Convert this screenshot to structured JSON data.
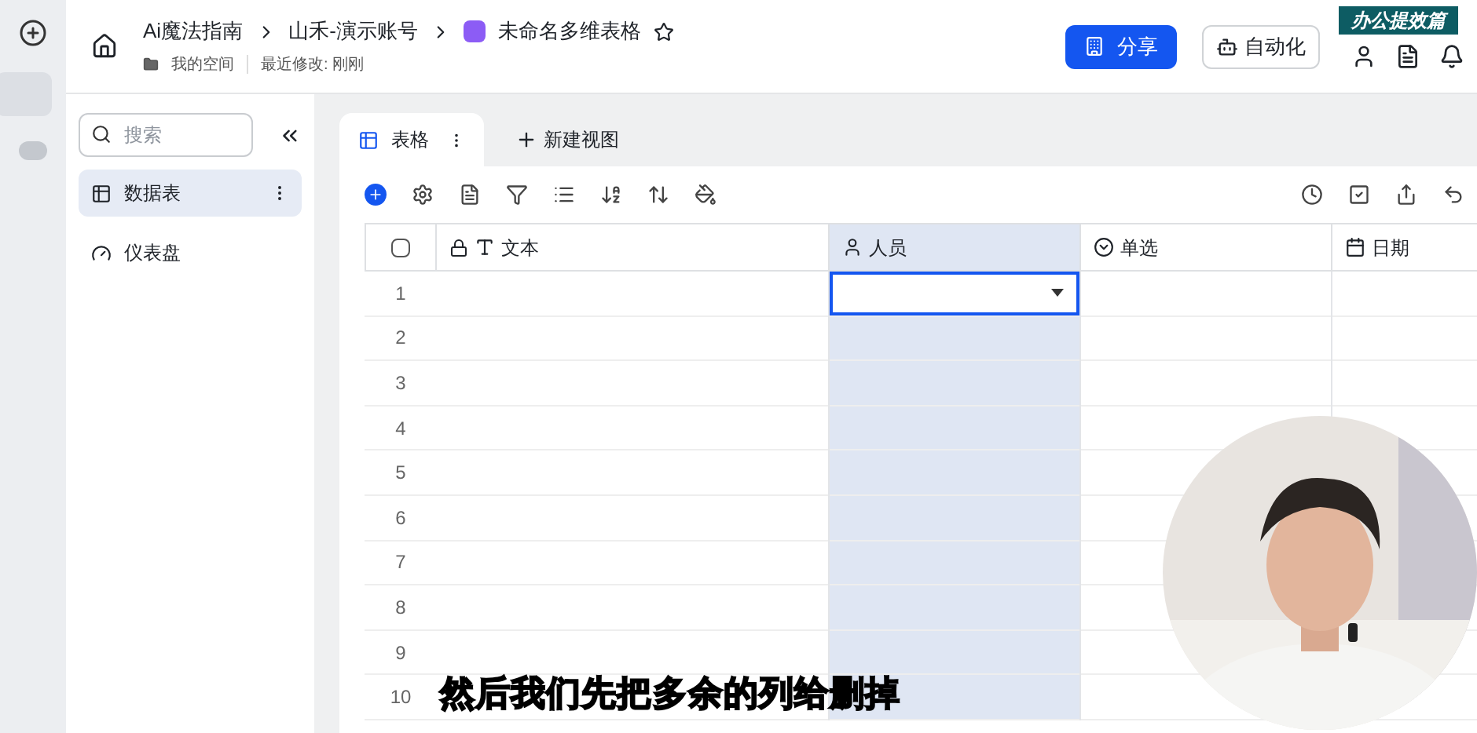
{
  "header": {
    "breadcrumb": [
      "Ai魔法指南",
      "山禾-演示账号"
    ],
    "doc_title": "未命名多维表格",
    "location": "我的空间",
    "modified": "最近修改: 刚刚",
    "share_button": "分享",
    "automation_button": "自动化"
  },
  "sidebar": {
    "search_placeholder": "搜索",
    "items": [
      {
        "label": "数据表",
        "kind": "table",
        "selected": true
      },
      {
        "label": "仪表盘",
        "kind": "dashboard",
        "selected": false
      }
    ]
  },
  "view_tabs": [
    {
      "label": "表格",
      "selected": true
    }
  ],
  "new_view": "新建视图",
  "table": {
    "columns": [
      {
        "label": "文本",
        "kind": "text",
        "selected": false
      },
      {
        "label": "人员",
        "kind": "person",
        "selected": true
      },
      {
        "label": "单选",
        "kind": "select",
        "selected": false
      },
      {
        "label": "日期",
        "kind": "date",
        "selected": false
      }
    ],
    "select_all_checked": false,
    "rows": [
      {
        "number": "1",
        "active": true
      },
      {
        "number": "2",
        "active": false
      },
      {
        "number": "3",
        "active": false
      },
      {
        "number": "4",
        "active": false
      },
      {
        "number": "5",
        "active": false
      },
      {
        "number": "6",
        "active": false
      },
      {
        "number": "7",
        "active": false
      },
      {
        "number": "8",
        "active": false
      },
      {
        "number": "9",
        "active": false
      },
      {
        "number": "10",
        "active": false
      }
    ]
  },
  "subtitle": "然后我们先把多余的列给删掉",
  "series_badge": "办公提效篇"
}
